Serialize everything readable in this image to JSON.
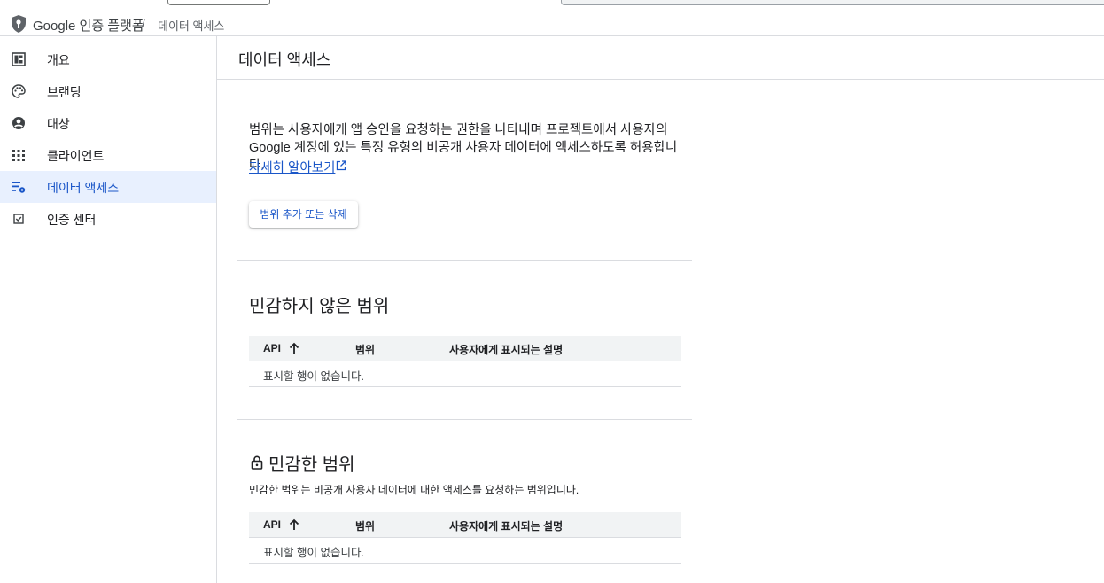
{
  "breadcrumb": {
    "product": "Google 인증 플랫폼",
    "separator": "/",
    "current": "데이터 액세스"
  },
  "sidebar": {
    "items": [
      {
        "label": "개요",
        "icon": "dashboard-icon"
      },
      {
        "label": "브랜딩",
        "icon": "palette-icon"
      },
      {
        "label": "대상",
        "icon": "account-circle-icon"
      },
      {
        "label": "클라이언트",
        "icon": "apps-grid-icon"
      },
      {
        "label": "데이터 액세스",
        "icon": "data-settings-icon",
        "active": true
      },
      {
        "label": "인증 센터",
        "icon": "verified-check-icon"
      }
    ]
  },
  "main": {
    "title": "데이터 액세스",
    "description": "범위는 사용자에게 앱 승인을 요청하는 권한을 나타내며 프로젝트에서 사용자의 Google 계정에 있는 특정 유형의 비공개 사용자 데이터에 액세스하도록 허용합니다.",
    "learn_more": "자세히 알아보기",
    "add_button": "범위 추가 또는 삭제",
    "non_sensitive": {
      "title": "민감하지 않은 범위",
      "columns": [
        "API",
        "범위",
        "사용자에게 표시되는 설명"
      ],
      "empty": "표시할 행이 없습니다."
    },
    "sensitive": {
      "title": "민감한 범위",
      "subtitle": "민감한 범위는 비공개 사용자 데이터에 대한 액세스를 요청하는 범위입니다.",
      "columns": [
        "API",
        "범위",
        "사용자에게 표시되는 설명"
      ],
      "empty": "표시할 행이 없습니다."
    }
  },
  "colors": {
    "accent": "#1a56c8",
    "active_bg": "#e8f0fe",
    "table_header_bg": "#f1f3f4",
    "divider": "#dadce0"
  }
}
